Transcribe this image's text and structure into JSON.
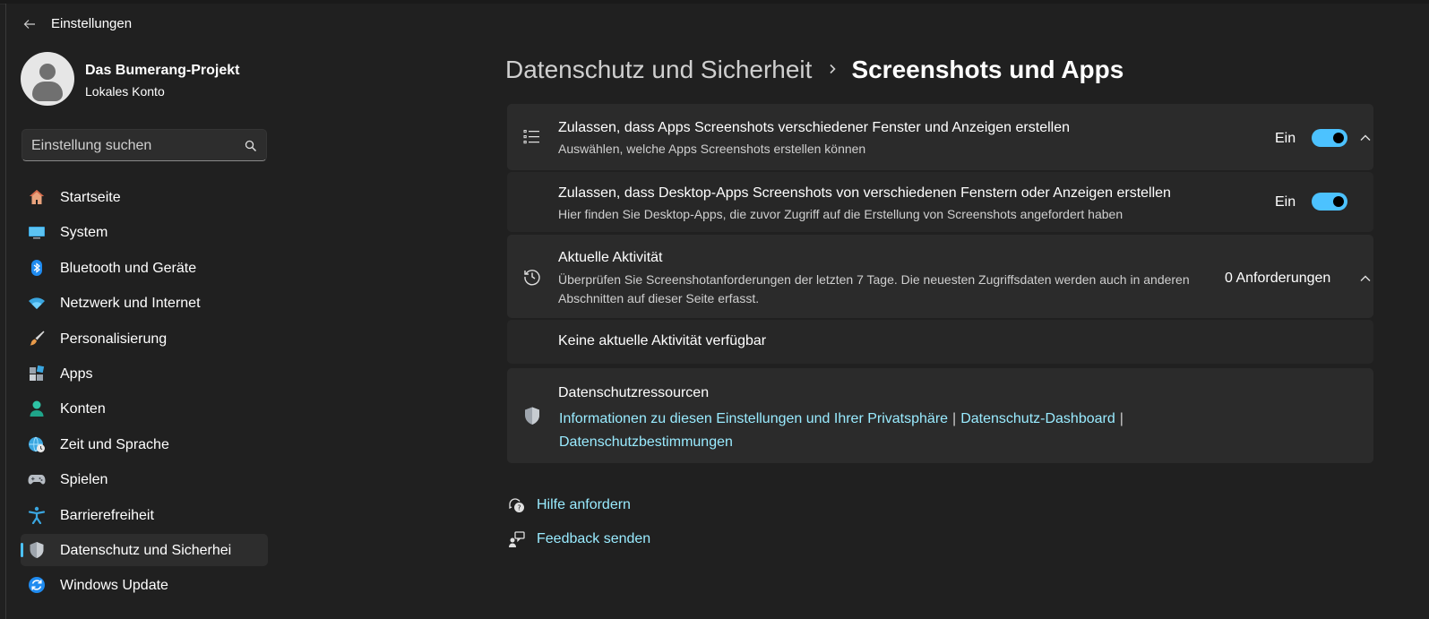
{
  "app": {
    "title": "Einstellungen"
  },
  "profile": {
    "name": "Das Bumerang-Projekt",
    "account_type": "Lokales Konto"
  },
  "search": {
    "placeholder": "Einstellung suchen"
  },
  "sidebar": {
    "items": [
      {
        "label": "Startseite",
        "icon": "home-icon",
        "selected": false
      },
      {
        "label": "System",
        "icon": "monitor-icon",
        "selected": false
      },
      {
        "label": "Bluetooth und Geräte",
        "icon": "bluetooth-icon",
        "selected": false
      },
      {
        "label": "Netzwerk und Internet",
        "icon": "wifi-icon",
        "selected": false
      },
      {
        "label": "Personalisierung",
        "icon": "brush-icon",
        "selected": false
      },
      {
        "label": "Apps",
        "icon": "apps-icon",
        "selected": false
      },
      {
        "label": "Konten",
        "icon": "person-icon",
        "selected": false
      },
      {
        "label": "Zeit und Sprache",
        "icon": "globe-clock-icon",
        "selected": false
      },
      {
        "label": "Spielen",
        "icon": "gamepad-icon",
        "selected": false
      },
      {
        "label": "Barrierefreiheit",
        "icon": "accessibility-icon",
        "selected": false
      },
      {
        "label": "Datenschutz und Sicherhei",
        "icon": "shield-icon",
        "selected": true
      },
      {
        "label": "Windows Update",
        "icon": "update-icon",
        "selected": false
      }
    ]
  },
  "breadcrumb": {
    "parent": "Datenschutz und Sicherheit",
    "current": "Screenshots und Apps"
  },
  "settings": {
    "apps_screenshots": {
      "title": "Zulassen, dass Apps Screenshots verschiedener Fenster und Anzeigen erstellen",
      "description": "Auswählen, welche Apps Screenshots erstellen können",
      "state_label": "Ein",
      "enabled": true
    },
    "desktop_apps_screenshots": {
      "title": "Zulassen, dass Desktop-Apps Screenshots von verschiedenen Fenstern oder Anzeigen erstellen",
      "description": "Hier finden Sie Desktop-Apps, die zuvor Zugriff auf die Erstellung von Screenshots angefordert haben",
      "state_label": "Ein",
      "enabled": true
    },
    "recent_activity": {
      "title": "Aktuelle Aktivität",
      "description": "Überprüfen Sie Screenshotanforderungen der letzten 7 Tage. Die neuesten Zugriffsdaten werden auch in anderen Abschnitten auf dieser Seite erfasst.",
      "count_label": "0 Anforderungen",
      "empty_text": "Keine aktuelle Aktivität verfügbar"
    },
    "privacy_resources": {
      "title": "Datenschutzressourcen",
      "link1": "Informationen zu diesen Einstellungen und Ihrer Privatsphäre",
      "link2": "Datenschutz-Dashboard",
      "link3": "Datenschutzbestimmungen",
      "separator": "|"
    }
  },
  "help": {
    "get_help": "Hilfe anfordern",
    "feedback": "Feedback senden"
  },
  "colors": {
    "accent": "#4cc2ff",
    "link": "#99ebff",
    "background": "#202020",
    "card": "#2b2b2b"
  }
}
